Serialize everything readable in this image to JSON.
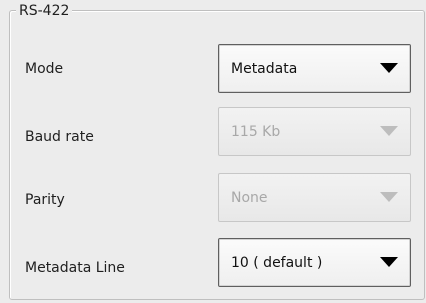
{
  "panel": {
    "title": "RS-422",
    "rows": [
      {
        "label": "Mode",
        "value": "Metadata",
        "enabled": true
      },
      {
        "label": "Baud rate",
        "value": "115 Kb",
        "enabled": false
      },
      {
        "label": "Parity",
        "value": "None",
        "enabled": false
      },
      {
        "label": "Metadata Line",
        "value": "10 ( default )",
        "enabled": true
      }
    ]
  },
  "icons": {
    "dropdown": "chevron-down-icon"
  },
  "colors": {
    "background": "#ececec",
    "border": "#bfbfbf",
    "text": "#1f1f1f",
    "disabled_text": "#a8a8a8",
    "arrow": "#000000",
    "disabled_arrow": "#bdbdbd"
  }
}
